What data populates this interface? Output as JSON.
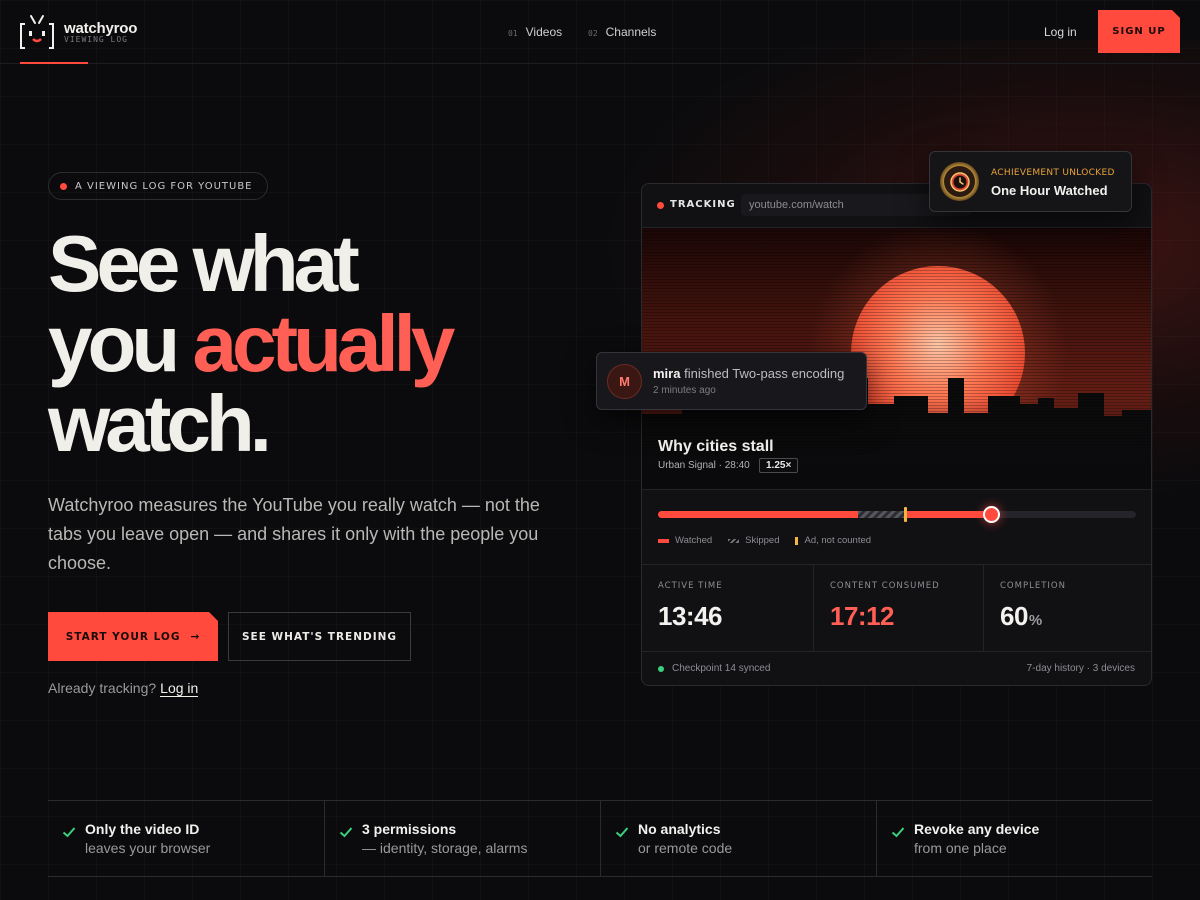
{
  "brand": {
    "name": "watchyroo",
    "tagline": "VIEWING LOG"
  },
  "nav": {
    "links": [
      {
        "num": "01",
        "label": "Videos"
      },
      {
        "num": "02",
        "label": "Channels"
      }
    ],
    "login": "Log in",
    "signup": "SIGN UP"
  },
  "hero": {
    "pill": "A VIEWING LOG FOR YOUTUBE",
    "headline": {
      "line1": "See what",
      "line2a": "you ",
      "line2b": "actually",
      "line3": "watch."
    },
    "lede": "Watchyroo measures the YouTube you really watch — not the tabs you leave open — and shares it only with the people you choose.",
    "cta_primary": "START YOUR LOG",
    "cta_arrow": "→",
    "cta_secondary": "SEE WHAT'S TRENDING",
    "already_text": "Already tracking?",
    "already_link": "Log in"
  },
  "tracker": {
    "status": "TRACKING",
    "url": "youtube.com/watch",
    "video": {
      "title": "Why cities stall",
      "meta": "Urban Signal · 28:40",
      "speed": "1.25×"
    },
    "legend": {
      "watched": "Watched",
      "skipped": "Skipped",
      "ad": "Ad, not counted"
    },
    "stats": [
      {
        "label": "ACTIVE TIME",
        "value": "13:46",
        "unit": ""
      },
      {
        "label": "CONTENT CONSUMED",
        "value": "17:12",
        "unit": ""
      },
      {
        "label": "COMPLETION",
        "value": "60",
        "unit": "%"
      }
    ],
    "footer_left": "Checkpoint 14 synced",
    "footer_right": "7-day history · 3 devices"
  },
  "achievement": {
    "kicker": "ACHIEVEMENT UNLOCKED",
    "title": "One Hour Watched"
  },
  "toast": {
    "initial": "M",
    "user": "mira",
    "action": "finished",
    "item": "Two-pass encoding",
    "time": "2 minutes ago"
  },
  "features": [
    {
      "title": "Only the video ID",
      "sub": "leaves your browser"
    },
    {
      "title": "3 permissions",
      "sub": "— identity, storage, alarms"
    },
    {
      "title": "No analytics",
      "sub": "or remote code"
    },
    {
      "title": "Revoke any device",
      "sub": "from one place"
    }
  ],
  "colors": {
    "accent": "#ff4a3d",
    "accent_text": "#ff5f55",
    "ad_marker": "#f6b53c",
    "sync_ok": "#3ad17a",
    "background": "#0b0b0d"
  },
  "icons": {
    "logo": "tv-face-icon",
    "check": "check-icon",
    "medal": "clock-medal-icon",
    "arrow": "arrow-right-icon"
  }
}
